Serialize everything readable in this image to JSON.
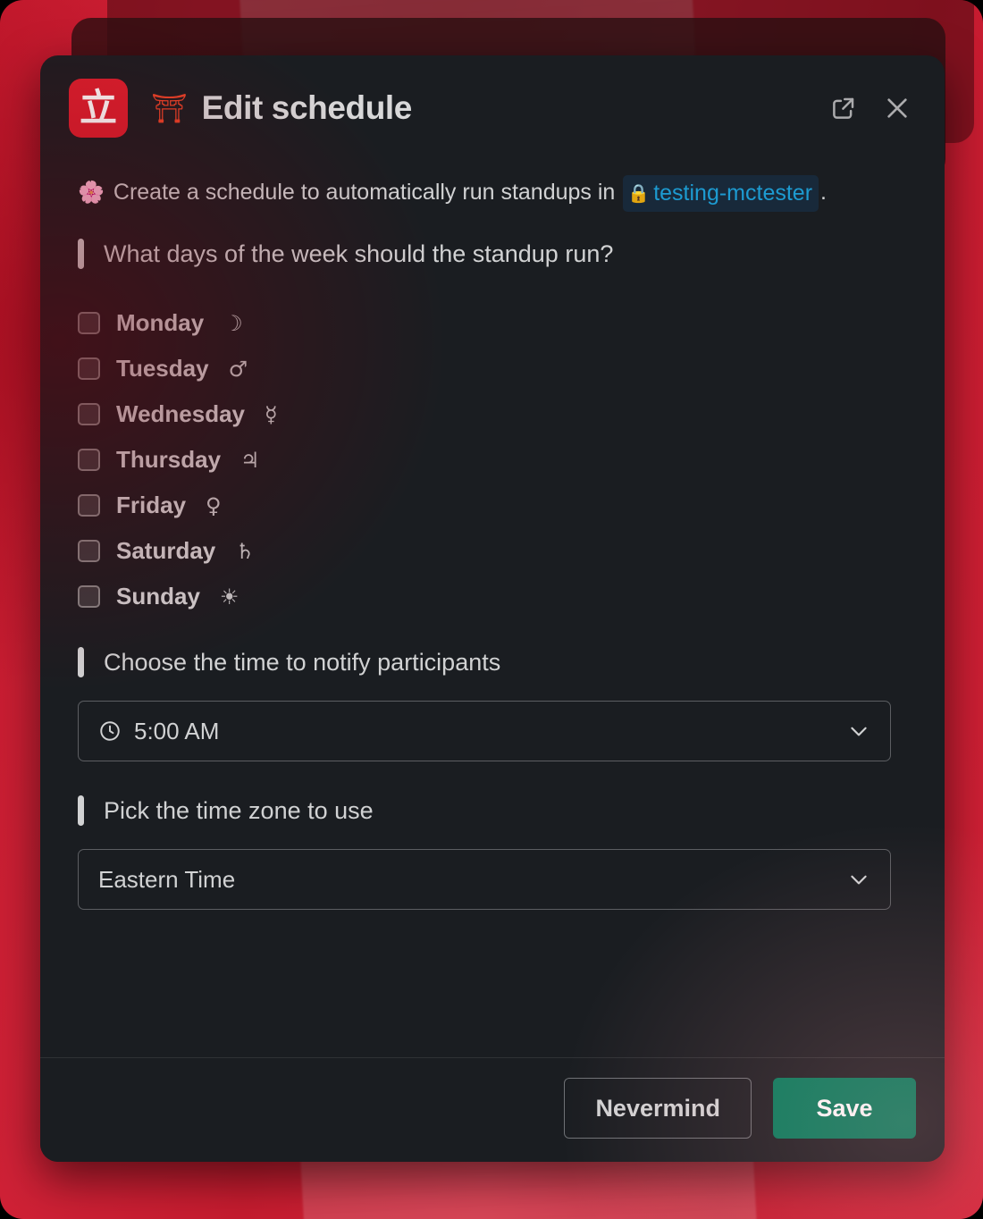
{
  "app": {
    "icon_glyph": "立",
    "icon_name": "standup-app-icon",
    "icon_color": "#da1f2e"
  },
  "header": {
    "title_emoji": "⛩",
    "title": "Edit schedule",
    "popout_label": "Open in new window",
    "close_label": "Close"
  },
  "intro": {
    "emoji": "🌸",
    "text_before": "Create a schedule to automatically run standups in",
    "channel_lock": "🔒",
    "channel_name": "testing-mctester",
    "text_after": ".",
    "channel_color": "#1d9bd1"
  },
  "days_section": {
    "label": "What days of the week should the standup run?",
    "days": [
      {
        "name": "Monday",
        "symbol": "☽",
        "checked": false
      },
      {
        "name": "Tuesday",
        "symbol": "♂",
        "checked": false
      },
      {
        "name": "Wednesday",
        "symbol": "☿",
        "checked": false
      },
      {
        "name": "Thursday",
        "symbol": "♃",
        "checked": false
      },
      {
        "name": "Friday",
        "symbol": "♀",
        "checked": false
      },
      {
        "name": "Saturday",
        "symbol": "♄",
        "checked": false
      },
      {
        "name": "Sunday",
        "symbol": "☀",
        "checked": false
      }
    ]
  },
  "time_section": {
    "label": "Choose the time to notify participants",
    "selected_value": "5:00 AM",
    "icon": "clock-icon"
  },
  "timezone_section": {
    "label": "Pick the time zone to use",
    "selected_value": "Eastern Time"
  },
  "footer": {
    "cancel_label": "Nevermind",
    "save_label": "Save",
    "save_color": "#017a5a"
  }
}
